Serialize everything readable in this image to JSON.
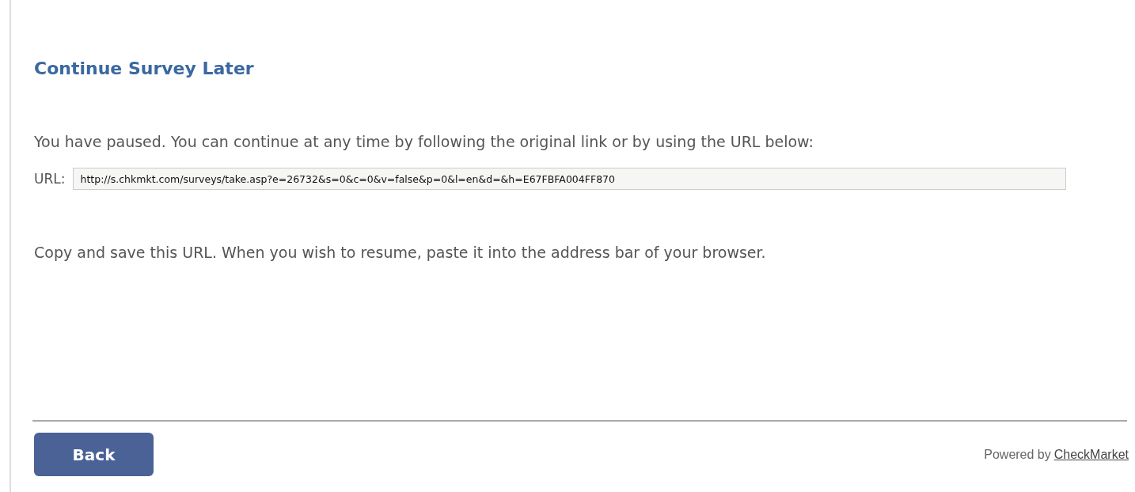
{
  "title": "Continue Survey Later",
  "intro": "You have paused. You can continue at any time by following the original link or by using the URL below:",
  "url_field": {
    "label": "URL:",
    "value": "http://s.chkmkt.com/surveys/take.asp?e=26732&s=0&c=0&v=false&p=0&l=en&d=&h=E67FBFA004FF870"
  },
  "instructions": "Copy and save this URL. When you wish to resume, paste it into the address bar of your browser.",
  "buttons": [
    "Back"
  ],
  "footer": {
    "text": "Powered by",
    "link": "CheckMarket"
  }
}
